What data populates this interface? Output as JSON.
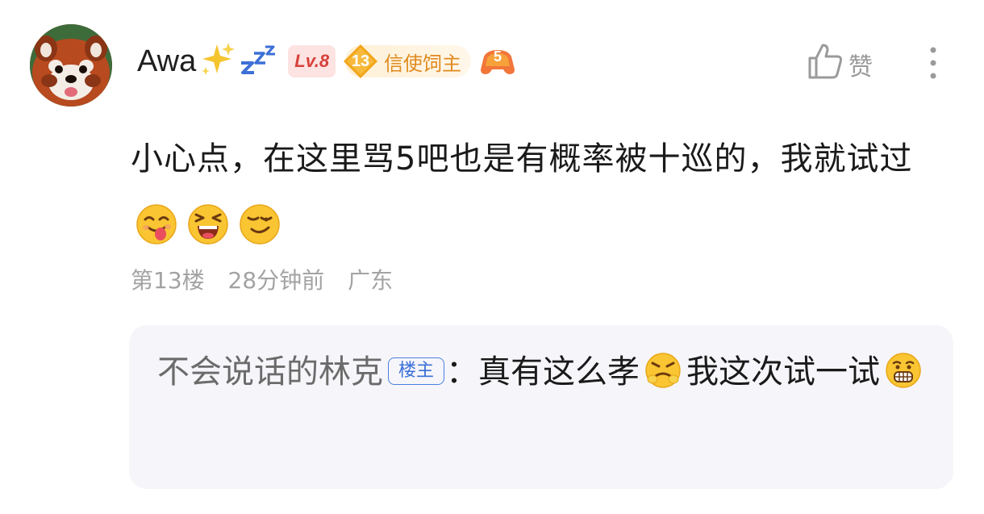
{
  "comment": {
    "username": "Awa",
    "level_badge": "Lv.8",
    "fan_level": "13",
    "fan_title": "信使饲主",
    "game_badge_number": "5",
    "like_label": "赞",
    "content_text": "小心点，在这里骂5吧也是有概率被十巡的，我就试过",
    "content_emojis": [
      "tongue-face-emoji",
      "laughing-face-emoji",
      "smirk-face-emoji"
    ],
    "floor": "第13楼",
    "time": "28分钟前",
    "location": "广东"
  },
  "reply": {
    "author": "不会说话的林克",
    "op_tag": "楼主",
    "separator": "：",
    "text_part1": "真有这么孝",
    "text_part2": "我这次试一试",
    "emojis": [
      "frustrated-face-emoji",
      "grimace-face-emoji"
    ]
  },
  "colors": {
    "level_badge_bg": "#fde3e1",
    "level_badge_text": "#d8413b",
    "fan_title_text": "#e08a1e",
    "op_tag": "#3a6fd8",
    "reply_bg": "#f6f6fa",
    "meta_text": "#a3a3a3"
  }
}
